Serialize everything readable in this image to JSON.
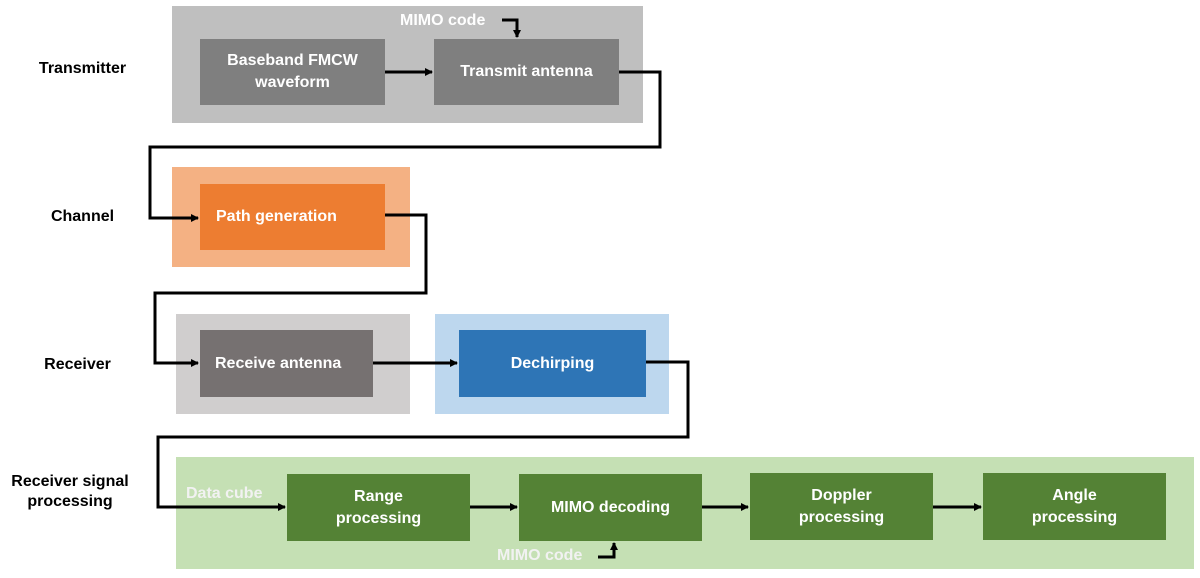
{
  "colors": {
    "transmitter_group": "#bfbfbf",
    "transmitter_block": "#7f7f7f",
    "channel_group": "#f4b183",
    "channel_block": "#ed7d31",
    "receiver_group": "#d0cece",
    "receive_antenna_block": "#767171",
    "dechirp_group": "#bdd7ee",
    "dechirp_block": "#2e75b6",
    "rsp_group": "#c5e0b4",
    "rsp_block": "#548235",
    "wire": "#000000"
  },
  "rows": [
    {
      "label": "Transmitter"
    },
    {
      "label": "Channel"
    },
    {
      "label": "Receiver"
    },
    {
      "label": "Receiver signal\nprocessing"
    }
  ],
  "blocks": {
    "baseband": "Baseband FMCW\nwaveform",
    "transmit_antenna": "Transmit antenna",
    "path_generation": "Path generation",
    "receive_antenna": "Receive antenna",
    "dechirping": "Dechirping",
    "range_processing": "Range\nprocessing",
    "mimo_decoding": "MIMO decoding",
    "doppler_processing": "Doppler\nprocessing",
    "angle_processing": "Angle\nprocessing"
  },
  "notes": {
    "tx_mimo_code": "MIMO code",
    "data_cube": "Data cube",
    "rx_mimo_code": "MIMO code"
  }
}
